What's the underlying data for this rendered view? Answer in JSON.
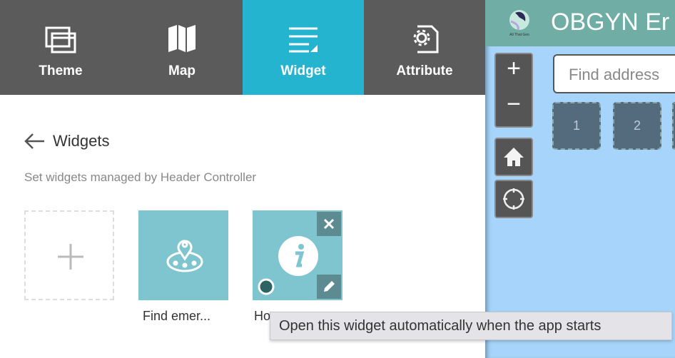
{
  "nav": {
    "tabs": [
      {
        "label": "Theme",
        "icon": "theme-icon"
      },
      {
        "label": "Map",
        "icon": "map-icon"
      },
      {
        "label": "Widget",
        "icon": "widget-icon",
        "active": true
      },
      {
        "label": "Attribute",
        "icon": "attribute-icon"
      }
    ]
  },
  "panel": {
    "title": "Widgets",
    "subtitle": "Set widgets managed by Header Controller",
    "widgets": [
      {
        "label": "Find emer...",
        "icon": "location-pin-icon"
      },
      {
        "label": "Ho",
        "icon": "info-icon",
        "open_at_start": true
      }
    ]
  },
  "map": {
    "title": "OBGYN Er",
    "logo_text": "All That Geo",
    "search_placeholder": "Find address",
    "placeholders": [
      "1",
      "2"
    ]
  },
  "tooltip": "Open this widget automatically when the app starts",
  "colors": {
    "nav": "#5b5b5b",
    "active_tab": "#24b4cf",
    "tile": "#7fc5cf",
    "header": "#6fada5",
    "map": "#a6d4fa"
  }
}
